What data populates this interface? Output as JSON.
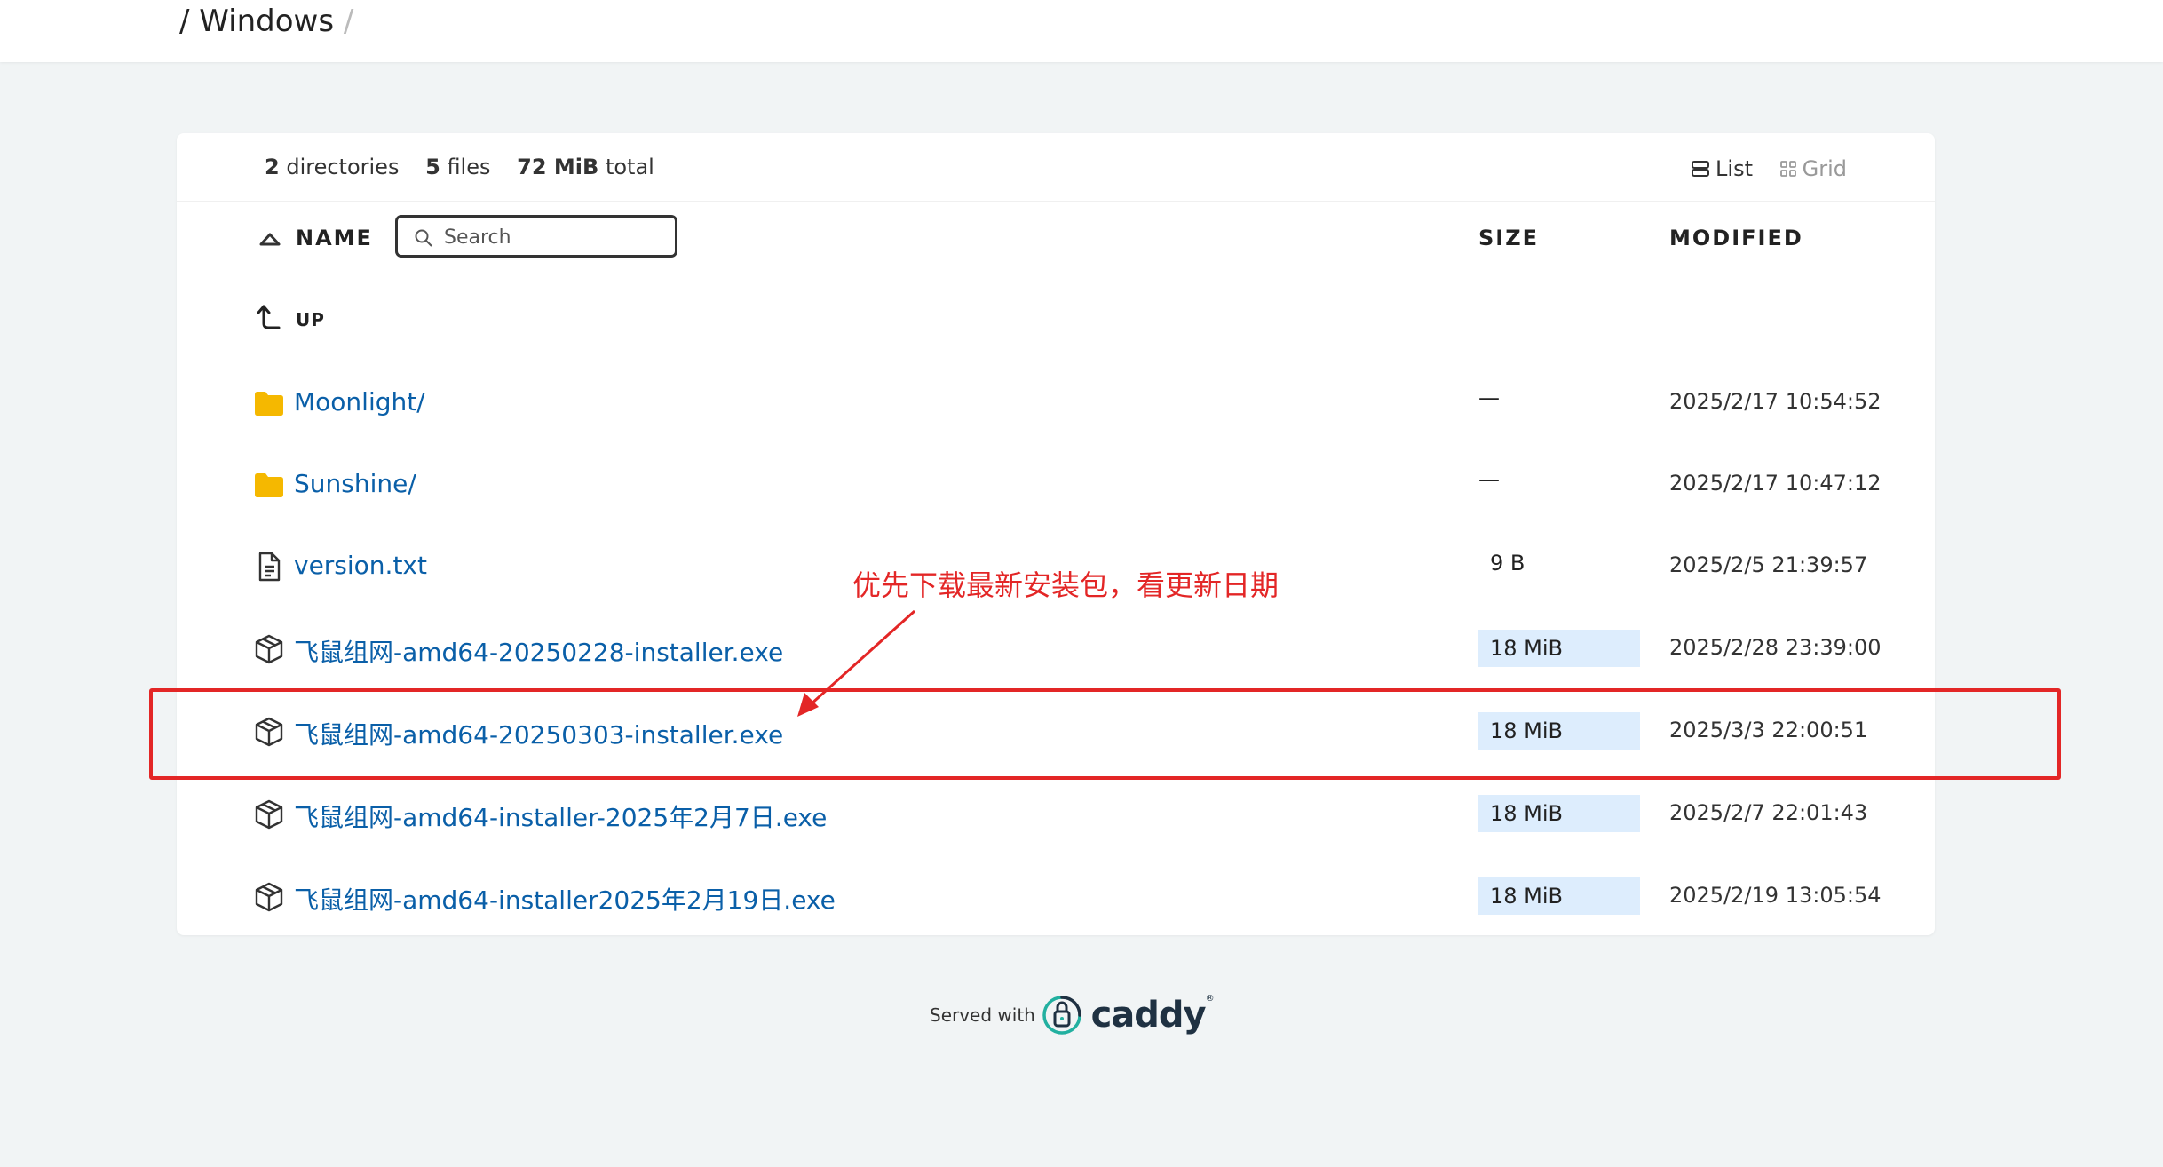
{
  "breadcrumb": {
    "separator": "/",
    "current": "Windows",
    "trailing": "/"
  },
  "summary": {
    "dir_count": "2",
    "dir_label": "directories",
    "file_count": "5",
    "file_label": "files",
    "total_size": "72 MiB",
    "total_label": "total"
  },
  "layout": {
    "list_label": "List",
    "grid_label": "Grid",
    "active": "List"
  },
  "columns": {
    "name": "NAME",
    "size": "SIZE",
    "modified": "MODIFIED"
  },
  "search": {
    "placeholder": "Search",
    "value": ""
  },
  "up_label": "UP",
  "entries": [
    {
      "type": "folder",
      "name": "Moonlight/",
      "size": "—",
      "modified": "2025/2/17 10:54:52",
      "size_fill": 0
    },
    {
      "type": "folder",
      "name": "Sunshine/",
      "size": "—",
      "modified": "2025/2/17 10:47:12",
      "size_fill": 0
    },
    {
      "type": "file",
      "name": "version.txt",
      "size": "9 B",
      "modified": "2025/2/5 21:39:57",
      "size_fill": 0
    },
    {
      "type": "package",
      "name": "飞鼠组网-amd64-20250228-installer.exe",
      "size": "18 MiB",
      "modified": "2025/2/28 23:39:00",
      "size_fill": 1
    },
    {
      "type": "package",
      "name": "飞鼠组网-amd64-20250303-installer.exe",
      "size": "18 MiB",
      "modified": "2025/3/3 22:00:51",
      "size_fill": 1
    },
    {
      "type": "package",
      "name": "飞鼠组网-amd64-installer-2025年2月7日.exe",
      "size": "18 MiB",
      "modified": "2025/2/7 22:01:43",
      "size_fill": 1
    },
    {
      "type": "package",
      "name": "飞鼠组网-amd64-installer2025年2月19日.exe",
      "size": "18 MiB",
      "modified": "2025/2/19 13:05:54",
      "size_fill": 1
    }
  ],
  "annotation": {
    "text": "优先下载最新安装包，看更新日期",
    "color": "#e32626"
  },
  "footer": {
    "served_with": "Served with",
    "brand": "caddy",
    "trademark": "®"
  },
  "colors": {
    "link": "#0a5fa8",
    "folder": "#f5b800",
    "size_bar": "#ddedfd",
    "background": "#f1f4f5"
  }
}
